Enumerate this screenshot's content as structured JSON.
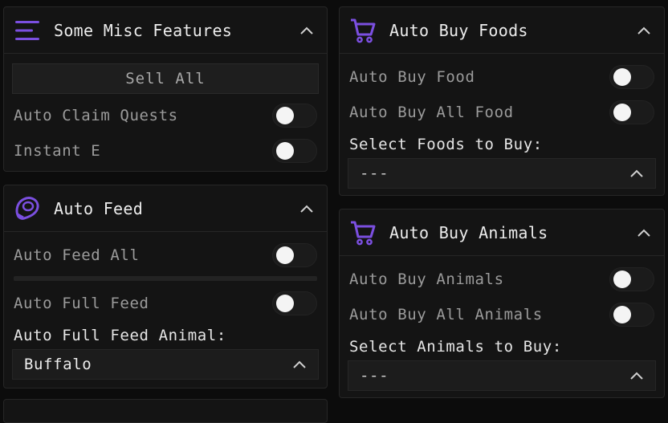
{
  "misc": {
    "title": "Some Misc Features",
    "icon": "menu-icon",
    "sell_all": "Sell All",
    "toggles": [
      {
        "label": "Auto Claim Quests",
        "on": false
      },
      {
        "label": "Instant E",
        "on": false
      }
    ]
  },
  "auto_feed": {
    "title": "Auto Feed",
    "icon": "meat-icon",
    "toggles": [
      {
        "label": "Auto Feed All",
        "on": false
      },
      {
        "label": "Auto Full Feed",
        "on": false
      }
    ],
    "animal_label": "Auto Full Feed Animal:",
    "animal_value": "Buffalo"
  },
  "buy_foods": {
    "title": "Auto Buy Foods",
    "icon": "cart-icon",
    "toggles": [
      {
        "label": "Auto Buy Food",
        "on": false
      },
      {
        "label": "Auto Buy All Food",
        "on": false
      }
    ],
    "select_label": "Select Foods to Buy:",
    "select_value": "---"
  },
  "buy_animals": {
    "title": "Auto Buy Animals",
    "icon": "cart-icon",
    "toggles": [
      {
        "label": "Auto Buy Animals",
        "on": false
      },
      {
        "label": "Auto Buy All Animals",
        "on": false
      }
    ],
    "select_label": "Select Animals to Buy:",
    "select_value": "---"
  },
  "colors": {
    "accent": "#7b4fe0",
    "panel_bg": "#141414",
    "page_bg": "#0c0c0c"
  }
}
